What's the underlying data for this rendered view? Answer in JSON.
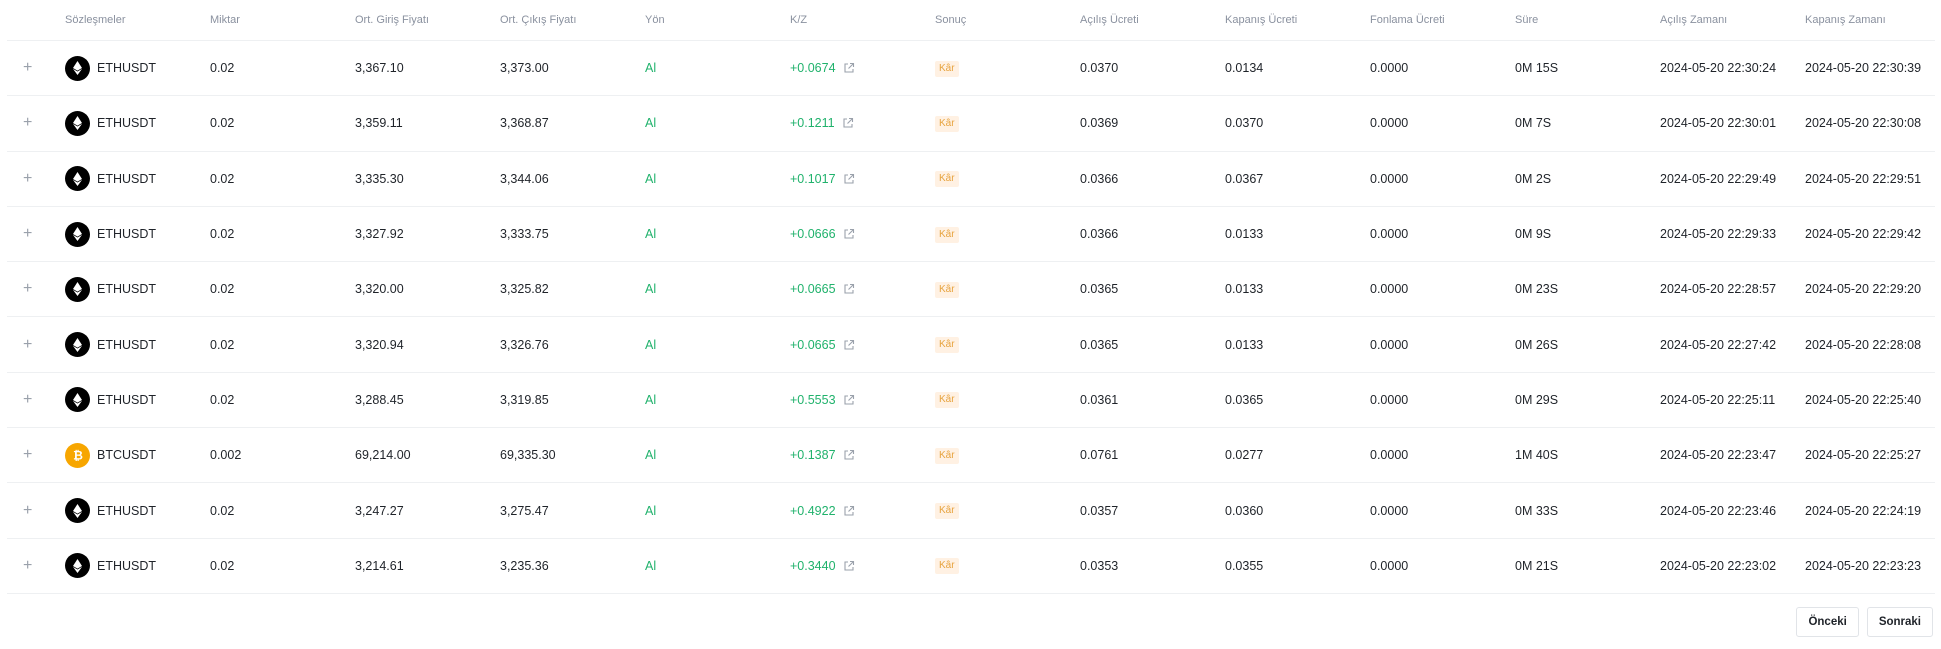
{
  "columns": [
    "Sözleşmeler",
    "Miktar",
    "Ort. Giriş Fiyatı",
    "Ort. Çıkış Fiyatı",
    "Yön",
    "K/Z",
    "Sonuç",
    "Açılış Ücreti",
    "Kapanış Ücreti",
    "Fonlama Ücreti",
    "Süre",
    "Açılış Zamanı",
    "Kapanış Zamanı"
  ],
  "rows": [
    {
      "symbol": "ETHUSDT",
      "coin": "eth",
      "qty": "0.02",
      "entry": "3,367.10",
      "exit": "3,373.00",
      "side": "Al",
      "pnl": "+0.0674",
      "result": "Kâr",
      "open_fee": "0.0370",
      "close_fee": "0.0134",
      "funding": "0.0000",
      "duration": "0M 15S",
      "open_time": "2024-05-20 22:30:24",
      "close_time": "2024-05-20 22:30:39"
    },
    {
      "symbol": "ETHUSDT",
      "coin": "eth",
      "qty": "0.02",
      "entry": "3,359.11",
      "exit": "3,368.87",
      "side": "Al",
      "pnl": "+0.1211",
      "result": "Kâr",
      "open_fee": "0.0369",
      "close_fee": "0.0370",
      "funding": "0.0000",
      "duration": "0M 7S",
      "open_time": "2024-05-20 22:30:01",
      "close_time": "2024-05-20 22:30:08"
    },
    {
      "symbol": "ETHUSDT",
      "coin": "eth",
      "qty": "0.02",
      "entry": "3,335.30",
      "exit": "3,344.06",
      "side": "Al",
      "pnl": "+0.1017",
      "result": "Kâr",
      "open_fee": "0.0366",
      "close_fee": "0.0367",
      "funding": "0.0000",
      "duration": "0M 2S",
      "open_time": "2024-05-20 22:29:49",
      "close_time": "2024-05-20 22:29:51"
    },
    {
      "symbol": "ETHUSDT",
      "coin": "eth",
      "qty": "0.02",
      "entry": "3,327.92",
      "exit": "3,333.75",
      "side": "Al",
      "pnl": "+0.0666",
      "result": "Kâr",
      "open_fee": "0.0366",
      "close_fee": "0.0133",
      "funding": "0.0000",
      "duration": "0M 9S",
      "open_time": "2024-05-20 22:29:33",
      "close_time": "2024-05-20 22:29:42"
    },
    {
      "symbol": "ETHUSDT",
      "coin": "eth",
      "qty": "0.02",
      "entry": "3,320.00",
      "exit": "3,325.82",
      "side": "Al",
      "pnl": "+0.0665",
      "result": "Kâr",
      "open_fee": "0.0365",
      "close_fee": "0.0133",
      "funding": "0.0000",
      "duration": "0M 23S",
      "open_time": "2024-05-20 22:28:57",
      "close_time": "2024-05-20 22:29:20"
    },
    {
      "symbol": "ETHUSDT",
      "coin": "eth",
      "qty": "0.02",
      "entry": "3,320.94",
      "exit": "3,326.76",
      "side": "Al",
      "pnl": "+0.0665",
      "result": "Kâr",
      "open_fee": "0.0365",
      "close_fee": "0.0133",
      "funding": "0.0000",
      "duration": "0M 26S",
      "open_time": "2024-05-20 22:27:42",
      "close_time": "2024-05-20 22:28:08"
    },
    {
      "symbol": "ETHUSDT",
      "coin": "eth",
      "qty": "0.02",
      "entry": "3,288.45",
      "exit": "3,319.85",
      "side": "Al",
      "pnl": "+0.5553",
      "result": "Kâr",
      "open_fee": "0.0361",
      "close_fee": "0.0365",
      "funding": "0.0000",
      "duration": "0M 29S",
      "open_time": "2024-05-20 22:25:11",
      "close_time": "2024-05-20 22:25:40"
    },
    {
      "symbol": "BTCUSDT",
      "coin": "btc",
      "qty": "0.002",
      "entry": "69,214.00",
      "exit": "69,335.30",
      "side": "Al",
      "pnl": "+0.1387",
      "result": "Kâr",
      "open_fee": "0.0761",
      "close_fee": "0.0277",
      "funding": "0.0000",
      "duration": "1M 40S",
      "open_time": "2024-05-20 22:23:47",
      "close_time": "2024-05-20 22:25:27"
    },
    {
      "symbol": "ETHUSDT",
      "coin": "eth",
      "qty": "0.02",
      "entry": "3,247.27",
      "exit": "3,275.47",
      "side": "Al",
      "pnl": "+0.4922",
      "result": "Kâr",
      "open_fee": "0.0357",
      "close_fee": "0.0360",
      "funding": "0.0000",
      "duration": "0M 33S",
      "open_time": "2024-05-20 22:23:46",
      "close_time": "2024-05-20 22:24:19"
    },
    {
      "symbol": "ETHUSDT",
      "coin": "eth",
      "qty": "0.02",
      "entry": "3,214.61",
      "exit": "3,235.36",
      "side": "Al",
      "pnl": "+0.3440",
      "result": "Kâr",
      "open_fee": "0.0353",
      "close_fee": "0.0355",
      "funding": "0.0000",
      "duration": "0M 21S",
      "open_time": "2024-05-20 22:23:02",
      "close_time": "2024-05-20 22:23:23"
    }
  ],
  "icons": {
    "expand": "plus-icon",
    "eth": "ethereum-icon",
    "btc": "bitcoin-icon",
    "link": "external-link-icon"
  },
  "colors": {
    "profit": "#20b26c",
    "badge_bg": "#fff1e3",
    "badge_text": "#e7a33e",
    "eth": "#000000",
    "btc": "#f7a600"
  },
  "pagination": {
    "prev_label": "Önceki",
    "next_label": "Sonraki"
  }
}
